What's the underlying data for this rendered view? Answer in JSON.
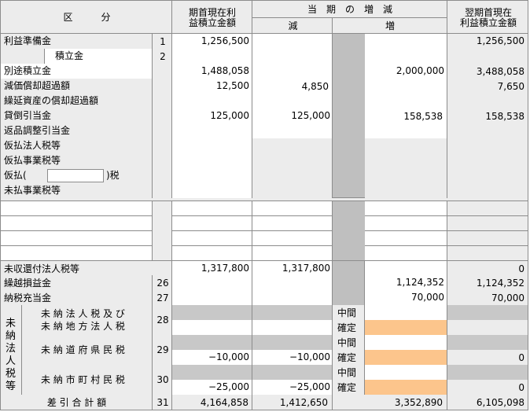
{
  "header": {
    "kubun": "区　　　分",
    "col1_line1": "期首現在利",
    "col1_line2": "益積立金額",
    "period_change": "当　期　の　増　減",
    "decrease": "減",
    "increase": "増",
    "col4_line1": "翌期首現在",
    "col4_line2": "利益積立金額"
  },
  "rows": {
    "r1": {
      "label": "利益準備金",
      "no": "1",
      "opening": "1,256,500",
      "dec": "",
      "inc": "",
      "closing": "1,256,500"
    },
    "r2": {
      "label": "積立金",
      "no": "2"
    },
    "r3": {
      "label": "別途積立金",
      "opening": "1,488,058",
      "dec": "",
      "inc": "2,000,000",
      "closing": "3,488,058"
    },
    "r4": {
      "label": "減価償却超過額",
      "opening": "12,500",
      "dec": "4,850",
      "inc": "",
      "closing": "7,650"
    },
    "r5": {
      "label": "繰延資産の償却超過額"
    },
    "r6": {
      "label": "貸倒引当金",
      "opening": "125,000",
      "dec": "125,000",
      "inc": "158,538",
      "closing": "158,538"
    },
    "r7": {
      "label": "返品調整引当金"
    },
    "r8": {
      "label": "仮払法人税等"
    },
    "r9": {
      "label": "仮払事業税等"
    },
    "r10": {
      "label_prefix": "仮払(",
      "label_suffix": ")税",
      "input_value": ""
    },
    "r11": {
      "label": "未払事業税等"
    },
    "r12": {
      "label": "未収還付法人税等",
      "opening": "1,317,800",
      "dec": "1,317,800",
      "inc": "",
      "closing": "0"
    },
    "r13": {
      "label": "繰越損益金",
      "no": "26",
      "opening": "",
      "dec": "",
      "inc": "1,124,352",
      "closing": "1,124,352"
    },
    "r14": {
      "label": "納税充当金",
      "no": "27",
      "opening": "",
      "dec": "",
      "inc": "70,000",
      "closing": "70,000"
    },
    "unpaid_group_label": "未納法人税等",
    "t28": {
      "label_line1": "未 納 法 人 税 及 び",
      "label_line2": "未 納 地 方 法 人 税",
      "no": "28",
      "mid": "中間",
      "conf": "確定",
      "closing": ""
    },
    "t29": {
      "label": "未 納 道 府 県 民 税",
      "no": "29",
      "opening": "−10,000",
      "dec": "−10,000",
      "mid": "中間",
      "conf": "確定",
      "closing": "0"
    },
    "t30": {
      "label": "未 納 市 町 村 民 税",
      "no": "30",
      "opening": "−25,000",
      "dec": "−25,000",
      "mid": "中間",
      "conf": "確定",
      "closing": "0"
    },
    "total": {
      "label": "差 引 合 計 額",
      "no": "31",
      "opening": "4,164,858",
      "dec": "1,412,650",
      "inc": "3,352,890",
      "closing": "6,105,098"
    }
  },
  "colors": {
    "gray": "#ececec",
    "dark_gray": "#bfbfbf",
    "orange": "#fcc58c",
    "border": "#8c8c8c"
  }
}
